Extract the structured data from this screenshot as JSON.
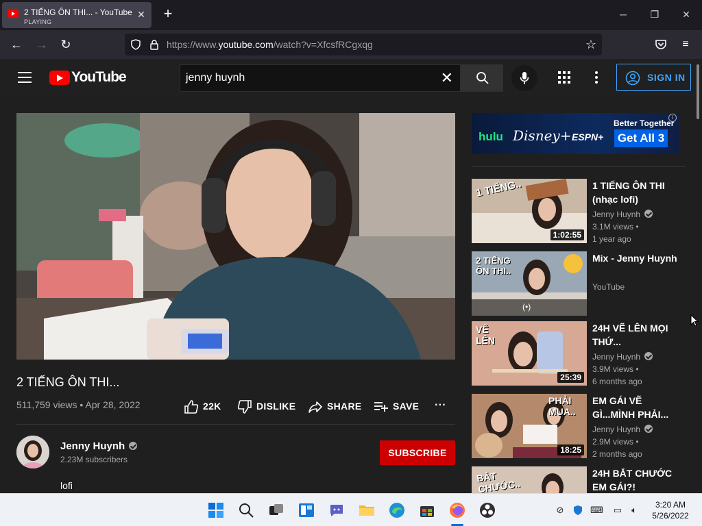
{
  "browser": {
    "tab_title": "2 TIẾNG ÔN THI... - YouTube",
    "tab_status": "PLAYING",
    "url_prefix": "https://www.",
    "url_domain": "youtube.com",
    "url_path": "/watch?v=XfcsfRCgxqg"
  },
  "youtube": {
    "logo_text": "YouTube",
    "search_value": "jenny huynh",
    "sign_in_label": "SIGN IN"
  },
  "video": {
    "title": "2 TIẾNG ÔN THI...",
    "views_date": "511,759 views • Apr 28, 2022",
    "like_count": "22K",
    "dislike_label": "DISLIKE",
    "share_label": "SHARE",
    "save_label": "SAVE",
    "more_label": "···",
    "channel_name": "Jenny Huynh",
    "subscribers": "2.23M subscribers",
    "subscribe_label": "SUBSCRIBE",
    "description": "lofi"
  },
  "ad": {
    "hulu": "hulu",
    "disney": "Disney+",
    "espn": "ESPN+",
    "better_together": "Better Together",
    "cta": "Get All 3",
    "info": "i"
  },
  "recommendations": [
    {
      "title": "1 TIẾNG ÔN THI (nhạc lofi)",
      "channel": "Jenny Huynh",
      "views": "3.1M views •",
      "age": "1 year ago",
      "duration": "1:02:55",
      "thumb_text": "1 TIẾNG..",
      "thumb_color": "#c9b8a6"
    },
    {
      "title": "Mix - Jenny Huynh",
      "channel": "YouTube",
      "views": "",
      "age": "",
      "duration": "",
      "thumb_text": "2 TIẾNG ÔN THI..",
      "thumb_color": "#9aa7b5"
    },
    {
      "title": "24H VẼ LÊN MỌI THỨ...",
      "channel": "Jenny Huynh",
      "views": "3.9M views •",
      "age": "6 months ago",
      "duration": "25:39",
      "thumb_text": "VẼ LÊN",
      "thumb_color": "#d7a894"
    },
    {
      "title": "EM GÁI VẼ GÌ...MÌNH PHẢI...",
      "channel": "Jenny Huynh",
      "views": "2.9M views •",
      "age": "2 months ago",
      "duration": "18:25",
      "thumb_text": "PHẢI MUA..",
      "thumb_color": "#b58a6c"
    },
    {
      "title": "24H BẮT CHƯỚC EM GÁI?!",
      "channel": "",
      "views": "",
      "age": "",
      "duration": "",
      "thumb_text": "BẮT CHƯỚC..",
      "thumb_color": "#d4c4b6"
    }
  ],
  "taskbar": {
    "time": "3:20 AM",
    "date": "5/26/2022"
  }
}
